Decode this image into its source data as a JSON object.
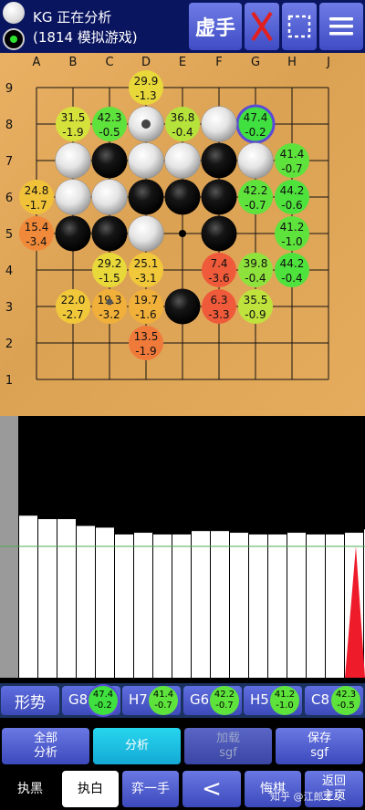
{
  "header": {
    "title": "KG  正在分析",
    "subtitle": "(1814 模拟游戏)",
    "virtual_move_label": "虚手"
  },
  "board": {
    "columns": [
      "A",
      "B",
      "C",
      "D",
      "E",
      "F",
      "G",
      "H",
      "J"
    ],
    "rows": [
      "9",
      "8",
      "7",
      "6",
      "5",
      "4",
      "3",
      "2",
      "1"
    ],
    "black_stones": [
      "C7",
      "F7",
      "D6",
      "E6",
      "F6",
      "B5",
      "C5",
      "F5",
      "E3"
    ],
    "white_stones": [
      "D8",
      "F8",
      "B7",
      "D7",
      "E7",
      "G7",
      "B6",
      "C6",
      "D5"
    ],
    "last_move": "D8",
    "hoshi": [
      "E5"
    ],
    "small_mark": "C3",
    "analysis": [
      {
        "point": "D9",
        "winrate": "29.9",
        "score": "-1.3",
        "color": "#e8d83a"
      },
      {
        "point": "B8",
        "winrate": "31.5",
        "score": "-1.9",
        "color": "#d6e23c"
      },
      {
        "point": "C8",
        "winrate": "42.3",
        "score": "-0.5",
        "color": "#5ee23c"
      },
      {
        "point": "E8",
        "winrate": "36.8",
        "score": "-0.4",
        "color": "#b6e23c"
      },
      {
        "point": "G8",
        "winrate": "47.4",
        "score": "-0.2",
        "color": "#3fe03f",
        "best": true
      },
      {
        "point": "H7",
        "winrate": "41.4",
        "score": "-0.7",
        "color": "#5ee23c"
      },
      {
        "point": "A6",
        "winrate": "24.8",
        "score": "-1.7",
        "color": "#f0c23a"
      },
      {
        "point": "G6",
        "winrate": "42.2",
        "score": "-0.7",
        "color": "#5ee23c"
      },
      {
        "point": "H6",
        "winrate": "44.2",
        "score": "-0.6",
        "color": "#4ee23c"
      },
      {
        "point": "A5",
        "winrate": "15.4",
        "score": "-3.4",
        "color": "#f08a3a"
      },
      {
        "point": "H5",
        "winrate": "41.2",
        "score": "-1.0",
        "color": "#5ee23c"
      },
      {
        "point": "C4",
        "winrate": "29.2",
        "score": "-1.5",
        "color": "#e8d83a"
      },
      {
        "point": "D4",
        "winrate": "25.1",
        "score": "-3.1",
        "color": "#f0c83a"
      },
      {
        "point": "F4",
        "winrate": "7.4",
        "score": "-3.6",
        "color": "#ef5a3a"
      },
      {
        "point": "G4",
        "winrate": "39.8",
        "score": "-0.4",
        "color": "#8ee23c"
      },
      {
        "point": "H4",
        "winrate": "44.2",
        "score": "-0.4",
        "color": "#4ee23c"
      },
      {
        "point": "B3",
        "winrate": "22.0",
        "score": "-2.7",
        "color": "#f0c83a"
      },
      {
        "point": "C3",
        "winrate": "19.3",
        "score": "-3.2",
        "color": "#f0b03a"
      },
      {
        "point": "D3",
        "winrate": "19.7",
        "score": "-1.6",
        "color": "#f0b03a"
      },
      {
        "point": "F3",
        "winrate": "6.3",
        "score": "-3.3",
        "color": "#ef5a3a"
      },
      {
        "point": "G3",
        "winrate": "35.5",
        "score": "-0.9",
        "color": "#bfe23c"
      },
      {
        "point": "D2",
        "winrate": "13.5",
        "score": "-1.9",
        "color": "#f07a3a"
      }
    ]
  },
  "graph": {
    "bars": [
      1.0,
      0.95,
      0.93,
      0.93,
      0.89,
      0.88,
      0.84,
      0.85,
      0.84,
      0.84,
      0.86,
      0.86,
      0.85,
      0.84,
      0.84,
      0.85,
      0.84,
      0.84,
      0.85,
      0.87,
      0.86
    ],
    "first_bar_color": "#9a9a9a"
  },
  "candidates": {
    "shape_label": "形势",
    "items": [
      {
        "move": "G8",
        "winrate": "47.4",
        "score": "-0.2",
        "color": "#3fe03f",
        "best": true
      },
      {
        "move": "H7",
        "winrate": "41.4",
        "score": "-0.7",
        "color": "#5ee23c"
      },
      {
        "move": "G6",
        "winrate": "42.2",
        "score": "-0.7",
        "color": "#5ee23c"
      },
      {
        "move": "H5",
        "winrate": "41.2",
        "score": "-1.0",
        "color": "#5ee23c"
      },
      {
        "move": "C8",
        "winrate": "42.3",
        "score": "-0.5",
        "color": "#5ee23c"
      }
    ]
  },
  "buttons": {
    "analyze_all": "全部\n分析",
    "analyze": "分析",
    "load_sgf": "加载\nsgf",
    "save_sgf": "保存\nsgf",
    "play_black": "执黑",
    "play_white": "执白",
    "play_one": "弈一手",
    "back": "<",
    "undo": "悔棋",
    "main_menu": "返回\n主页"
  },
  "watermark": "知乎 @江郎才尽"
}
